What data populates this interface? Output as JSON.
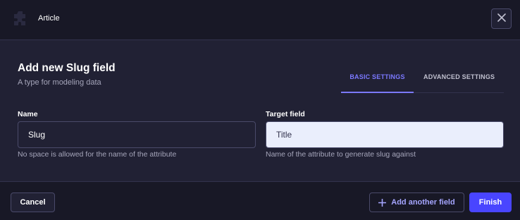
{
  "header": {
    "breadcrumb": "Article",
    "close_icon": "close-icon",
    "logo_icon": "puzzle-piece-icon"
  },
  "form": {
    "title": "Add new Slug field",
    "subtitle": "A type for modeling data",
    "tabs": [
      {
        "label": "BASIC SETTINGS",
        "active": true
      },
      {
        "label": "ADVANCED SETTINGS",
        "active": false
      }
    ],
    "fields": {
      "name": {
        "label": "Name",
        "value": "Slug",
        "hint": "No space is allowed for the name of the attribute"
      },
      "target": {
        "label": "Target field",
        "value": "Title",
        "hint": "Name of the attribute to generate slug against"
      }
    }
  },
  "footer": {
    "cancel_label": "Cancel",
    "add_label": "Add another field",
    "add_icon": "plus-icon",
    "finish_label": "Finish"
  },
  "colors": {
    "accent": "#4945ff",
    "tab_active": "#7b79ff",
    "background": "#212134",
    "header_bg": "#181826"
  }
}
